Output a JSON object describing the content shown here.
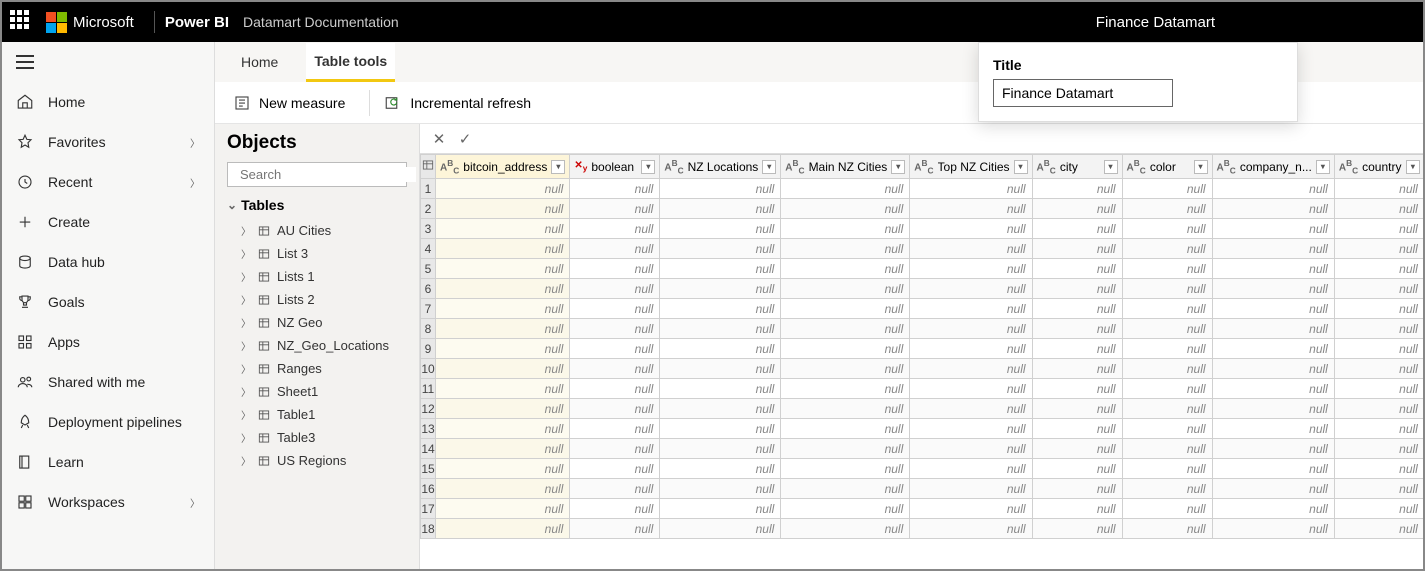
{
  "topbar": {
    "brand": "Microsoft",
    "product": "Power BI",
    "doc_title": "Datamart Documentation",
    "datamart_name": "Finance Datamart"
  },
  "title_popup": {
    "label": "Title",
    "value": "Finance Datamart"
  },
  "leftnav": {
    "items": [
      {
        "id": "home",
        "label": "Home",
        "icon": "home",
        "chevron": false
      },
      {
        "id": "favorites",
        "label": "Favorites",
        "icon": "star",
        "chevron": true
      },
      {
        "id": "recent",
        "label": "Recent",
        "icon": "clock",
        "chevron": true
      },
      {
        "id": "create",
        "label": "Create",
        "icon": "plus",
        "chevron": false
      },
      {
        "id": "datahub",
        "label": "Data hub",
        "icon": "cylinder",
        "chevron": false
      },
      {
        "id": "goals",
        "label": "Goals",
        "icon": "trophy",
        "chevron": false
      },
      {
        "id": "apps",
        "label": "Apps",
        "icon": "grid",
        "chevron": false
      },
      {
        "id": "shared",
        "label": "Shared with me",
        "icon": "people",
        "chevron": false
      },
      {
        "id": "pipelines",
        "label": "Deployment pipelines",
        "icon": "rocket",
        "chevron": false
      },
      {
        "id": "learn",
        "label": "Learn",
        "icon": "book",
        "chevron": false
      },
      {
        "id": "workspaces",
        "label": "Workspaces",
        "icon": "workspace",
        "chevron": true
      }
    ]
  },
  "tabs": {
    "home": "Home",
    "table_tools": "Table tools"
  },
  "ribbon": {
    "new_measure": "New measure",
    "incremental_refresh": "Incremental refresh"
  },
  "objects_panel": {
    "title": "Objects",
    "search_placeholder": "Search",
    "tables_header": "Tables",
    "tables": [
      "AU Cities",
      "List 3",
      "Lists 1",
      "Lists 2",
      "NZ Geo",
      "NZ_Geo_Locations",
      "Ranges",
      "Sheet1",
      "Table1",
      "Table3",
      "US Regions"
    ]
  },
  "grid": {
    "null_text": "null",
    "row_count": 18,
    "selected_column_index": 0,
    "columns": [
      {
        "label": "bitcoin_address",
        "type": "abc"
      },
      {
        "label": "boolean",
        "type": "xy"
      },
      {
        "label": "NZ Locations",
        "type": "abc"
      },
      {
        "label": "Main NZ Cities",
        "type": "abc"
      },
      {
        "label": "Top NZ Cities",
        "type": "abc"
      },
      {
        "label": "city",
        "type": "abc"
      },
      {
        "label": "color",
        "type": "abc"
      },
      {
        "label": "company_n...",
        "type": "abc"
      },
      {
        "label": "country",
        "type": "abc"
      }
    ]
  }
}
